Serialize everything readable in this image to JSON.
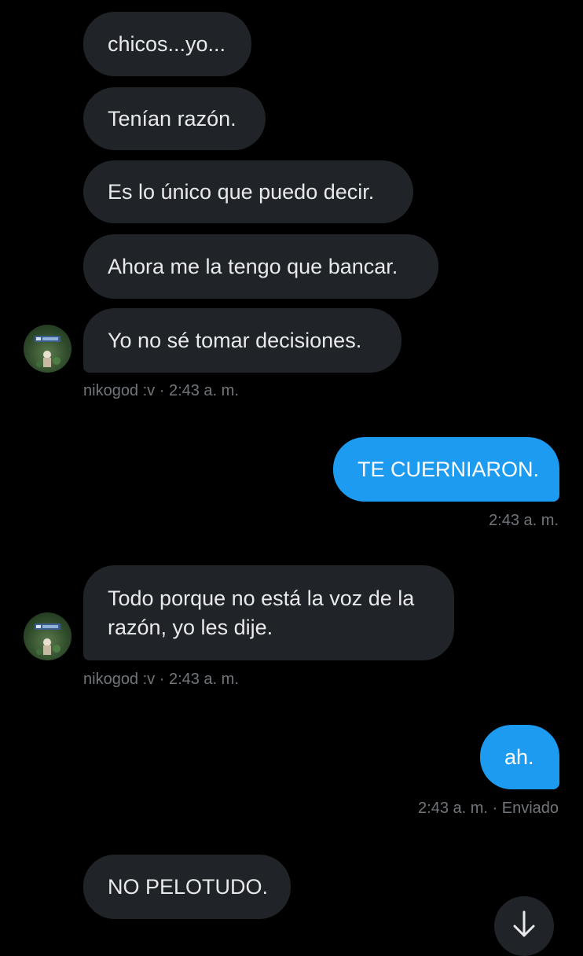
{
  "thread": {
    "incoming_group_1": [
      "chicos...yo...",
      "Tenían razón.",
      "Es lo único que puedo decir.",
      "Ahora me la tengo que bancar.",
      "Yo no sé tomar decisiones."
    ],
    "meta_1": "nikogod :v · 2:43 a. m.",
    "outgoing_1": "TE CUERNIARON.",
    "outgoing_1_meta": "2:43 a. m.",
    "incoming_2_line1": "Todo porque no está la voz de la",
    "incoming_2_line2": "razón, yo les dije.",
    "meta_2": "nikogod :v · 2:43 a. m.",
    "outgoing_2": "ah.",
    "outgoing_2_meta": "2:43 a. m. · Enviado",
    "incoming_3": "NO PELOTUDO."
  },
  "icons": {
    "avatar": "user-avatar",
    "scroll": "arrow-down-icon"
  },
  "colors": {
    "background": "#000000",
    "incoming_bubble": "#202327",
    "outgoing_bubble": "#1d9bf0",
    "meta_text": "#71767b"
  }
}
